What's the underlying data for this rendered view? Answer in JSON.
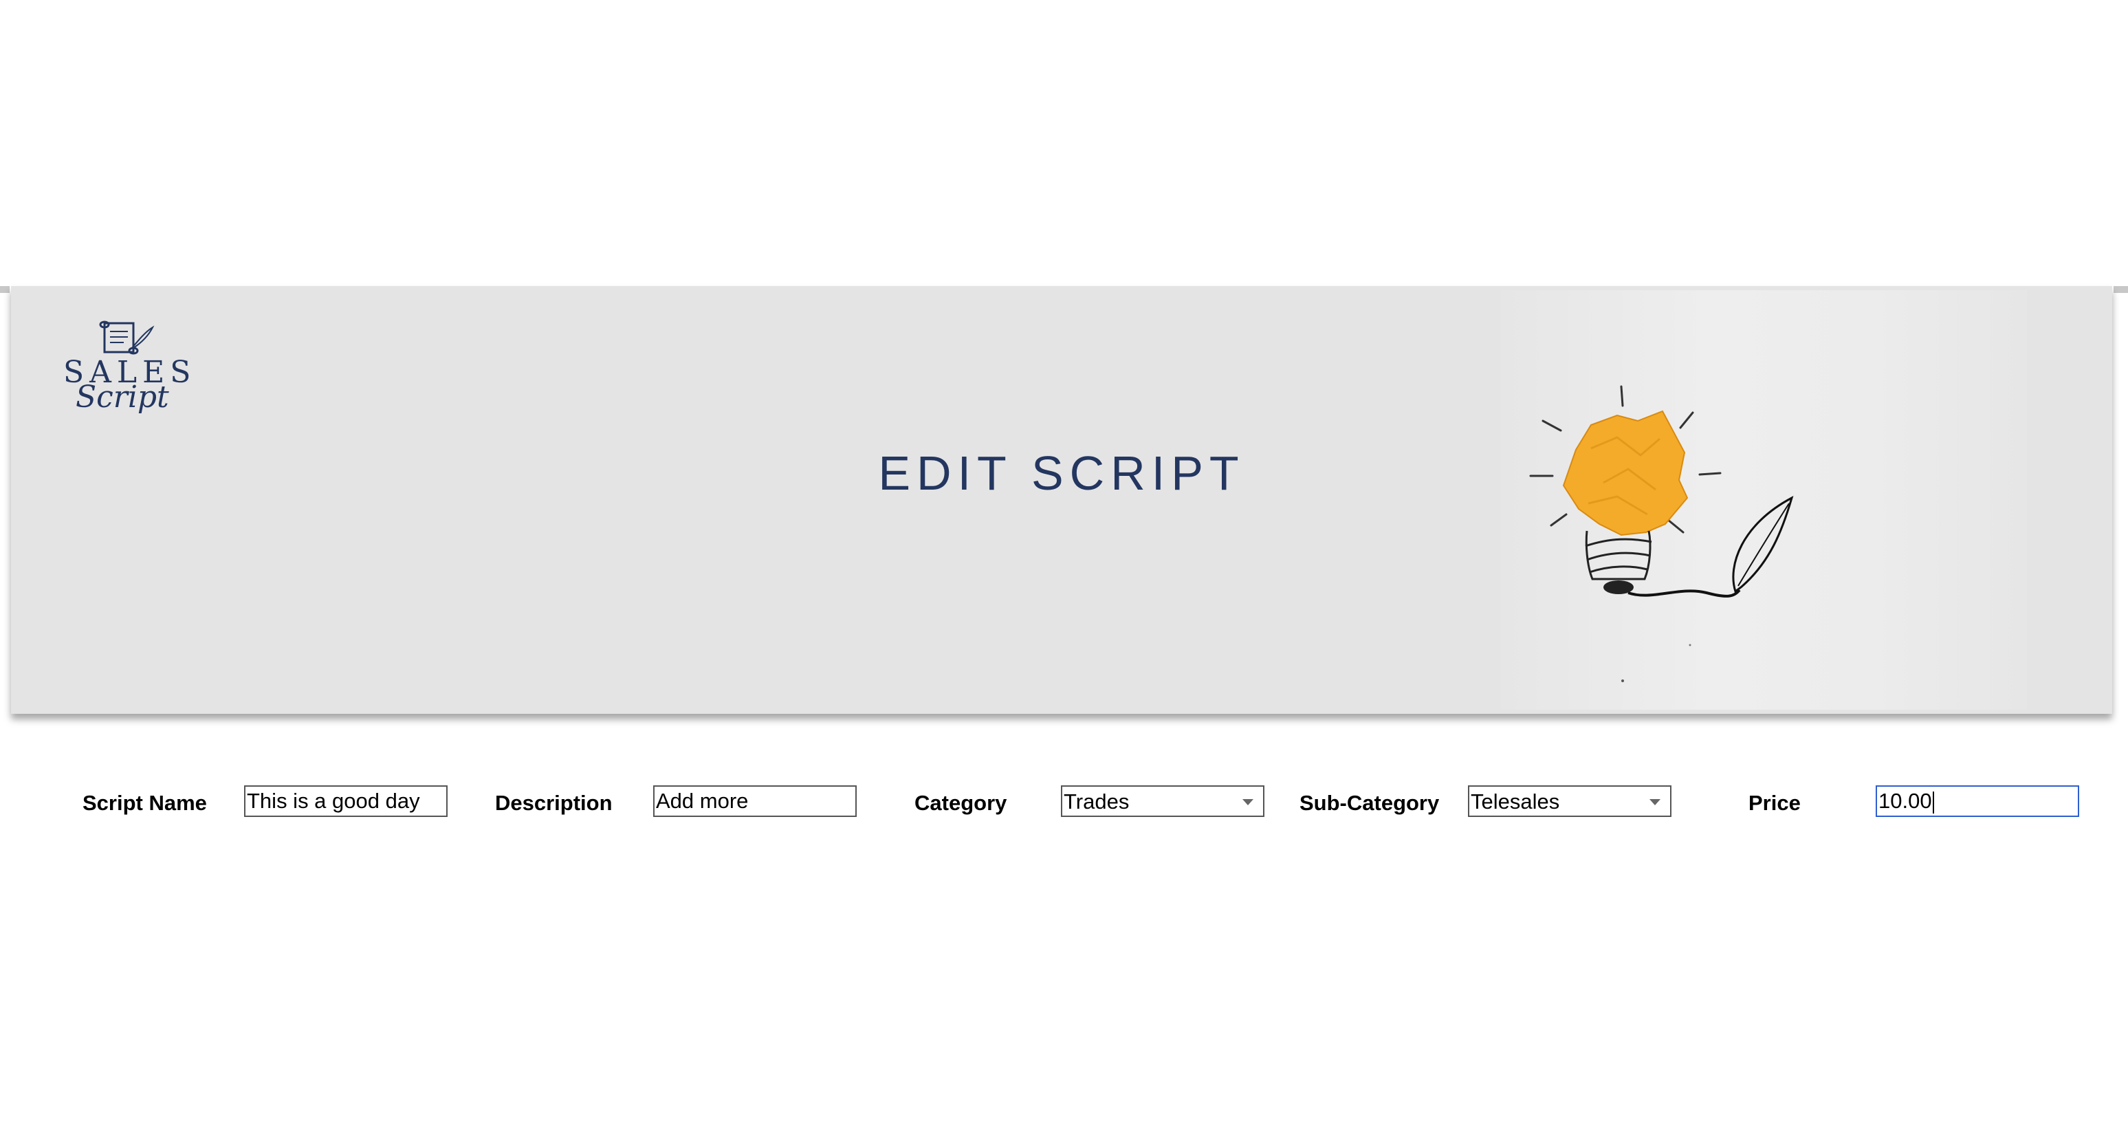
{
  "header": {
    "logo_line1": "SALES",
    "logo_line2": "Script",
    "title": "EDIT SCRIPT"
  },
  "form": {
    "script_name": {
      "label": "Script Name",
      "value": "This is a good day"
    },
    "description": {
      "label": "Description",
      "value": "Add more"
    },
    "category": {
      "label": "Category",
      "value": "Trades"
    },
    "sub_category": {
      "label": "Sub-Category",
      "value": "Telesales"
    },
    "price": {
      "label": "Price",
      "value": "10.00"
    }
  },
  "colors": {
    "brand_navy": "#233660",
    "banner_bg": "#e4e4e4",
    "bulb_yellow": "#f5ab2a",
    "focus_blue": "#2f5fd0"
  },
  "icons": {
    "logo": "scroll-quill-icon",
    "hero": "crumpled-paper-lightbulb-quill-illustration",
    "dropdown": "triangle-down-icon"
  }
}
